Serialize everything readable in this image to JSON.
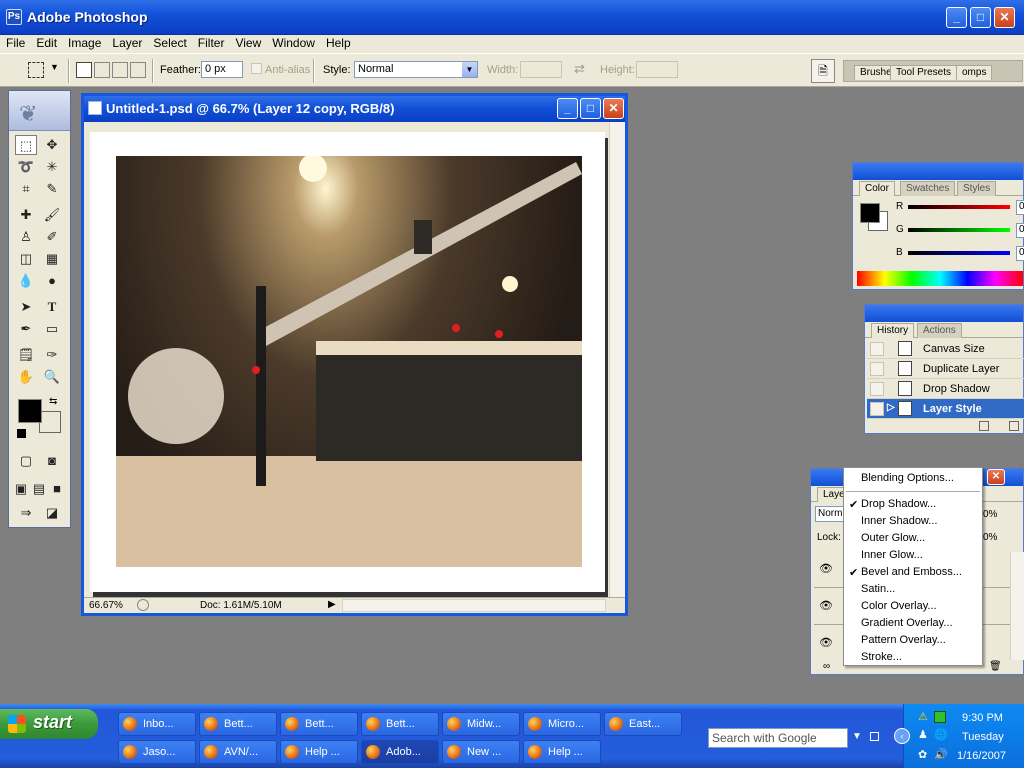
{
  "app": {
    "title": "Adobe Photoshop"
  },
  "menubar": [
    "File",
    "Edit",
    "Image",
    "Layer",
    "Select",
    "Filter",
    "View",
    "Window",
    "Help"
  ],
  "options": {
    "feather_label": "Feather:",
    "feather_value": "0 px",
    "antialias_label": "Anti-alias",
    "style_label": "Style:",
    "style_value": "Normal",
    "width_label": "Width:",
    "height_label": "Height:",
    "well_tabs": [
      "Brushe",
      "Tool Presets",
      "omps"
    ]
  },
  "document": {
    "title": "Untitled-1.psd @ 66.7% (Layer 12 copy, RGB/8)",
    "zoom": "66.67%",
    "doc_info": "Doc: 1.61M/5.10M"
  },
  "color_palette": {
    "tabs": [
      "Color",
      "Swatches",
      "Styles"
    ],
    "channels": [
      "R",
      "G",
      "B"
    ],
    "values": [
      "0",
      "0",
      "0"
    ],
    "fg_color": "#000000",
    "bg_color": "#ffffff"
  },
  "history_palette": {
    "tabs": [
      "History",
      "Actions"
    ],
    "items": [
      "Canvas Size",
      "Duplicate Layer",
      "Drop Shadow",
      "Layer Style"
    ]
  },
  "layers_palette": {
    "tab": "Laye",
    "blend_mode": "Norm",
    "opacity": "0%",
    "lock_label": "Lock:",
    "fill": "0%"
  },
  "context_menu": {
    "items": [
      {
        "label": "Blending Options...",
        "checked": false
      },
      {
        "label": "Drop Shadow...",
        "checked": true
      },
      {
        "label": "Inner Shadow...",
        "checked": false
      },
      {
        "label": "Outer Glow...",
        "checked": false
      },
      {
        "label": "Inner Glow...",
        "checked": false
      },
      {
        "label": "Bevel and Emboss...",
        "checked": true
      },
      {
        "label": "Satin...",
        "checked": false
      },
      {
        "label": "Color Overlay...",
        "checked": false
      },
      {
        "label": "Gradient Overlay...",
        "checked": false
      },
      {
        "label": "Pattern Overlay...",
        "checked": false
      },
      {
        "label": "Stroke...",
        "checked": false
      }
    ],
    "check_glyph": "✔"
  },
  "taskbar": {
    "start_label": "start",
    "row1": [
      "Inbo...",
      "Bett...",
      "Bett...",
      "Bett...",
      "Midw...",
      "Micro...",
      "East..."
    ],
    "row2": [
      "Jaso...",
      "AVN/...",
      "Help ...",
      "Adob...",
      "New ...",
      "Help ..."
    ],
    "search_placeholder": "Search with Google",
    "time": "9:30 PM",
    "day": "Tuesday",
    "date": "1/16/2007"
  }
}
